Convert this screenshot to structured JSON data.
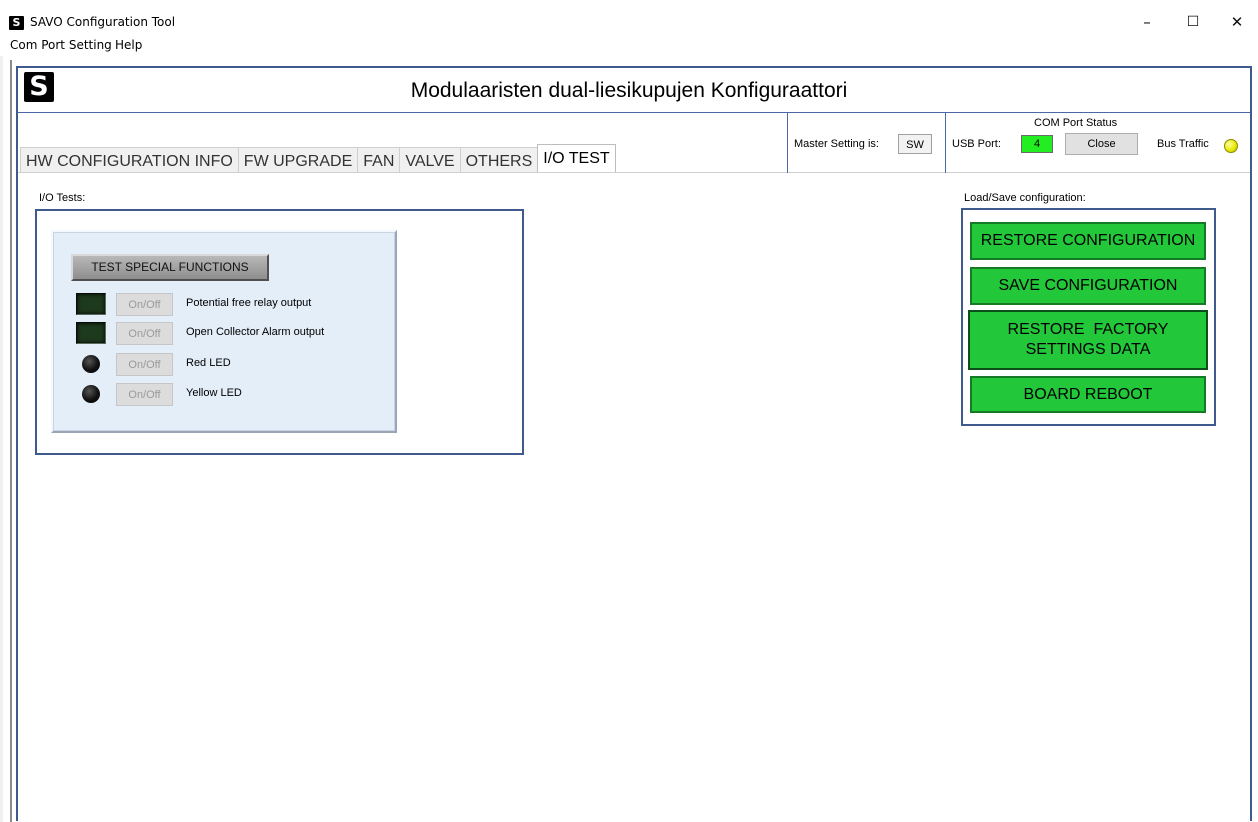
{
  "window": {
    "title": "SAVO Configuration Tool",
    "icon_letter": "S",
    "minimize_glyph": "–",
    "maximize_glyph": "☐",
    "close_glyph": "✕"
  },
  "menu": [
    "Com Port Setting",
    "Help"
  ],
  "header": {
    "logo_letter": "S",
    "title": "Modulaaristen dual-liesikupujen Konfiguraattori"
  },
  "tabs": [
    {
      "label": "HW CONFIGURATION INFO",
      "active": false
    },
    {
      "label": "FW UPGRADE",
      "active": false
    },
    {
      "label": "FAN",
      "active": false
    },
    {
      "label": "VALVE",
      "active": false
    },
    {
      "label": "OTHERS",
      "active": false
    },
    {
      "label": "I/O TEST",
      "active": true
    }
  ],
  "status": {
    "master_label": "Master Setting is:",
    "master_value": "SW",
    "com_port_status_title": "COM Port Status",
    "usb_port_label": "USB Port:",
    "usb_port_value": "4",
    "close_label": "Close",
    "bus_traffic_label": "Bus Traffic",
    "bus_traffic_led_color": "#e6e600"
  },
  "io_tests": {
    "label": "I/O Tests:",
    "test_special_label": "TEST SPECIAL FUNCTIONS",
    "rows": [
      {
        "indicator": "square",
        "button_label": "On/Off",
        "label": "Potential free relay output"
      },
      {
        "indicator": "square",
        "button_label": "On/Off",
        "label": "Open Collector Alarm output"
      },
      {
        "indicator": "round",
        "button_label": "On/Off",
        "label": "Red LED"
      },
      {
        "indicator": "round",
        "button_label": "On/Off",
        "label": "Yellow LED"
      }
    ]
  },
  "load_save": {
    "label": "Load/Save configuration:",
    "restore_config": "RESTORE CONFIGURATION",
    "save_config": "SAVE CONFIGURATION",
    "restore_factory_line1": "RESTORE  FACTORY",
    "restore_factory_line2": "SETTINGS DATA",
    "board_reboot": "BOARD REBOOT",
    "button_color": "#22c73a"
  }
}
